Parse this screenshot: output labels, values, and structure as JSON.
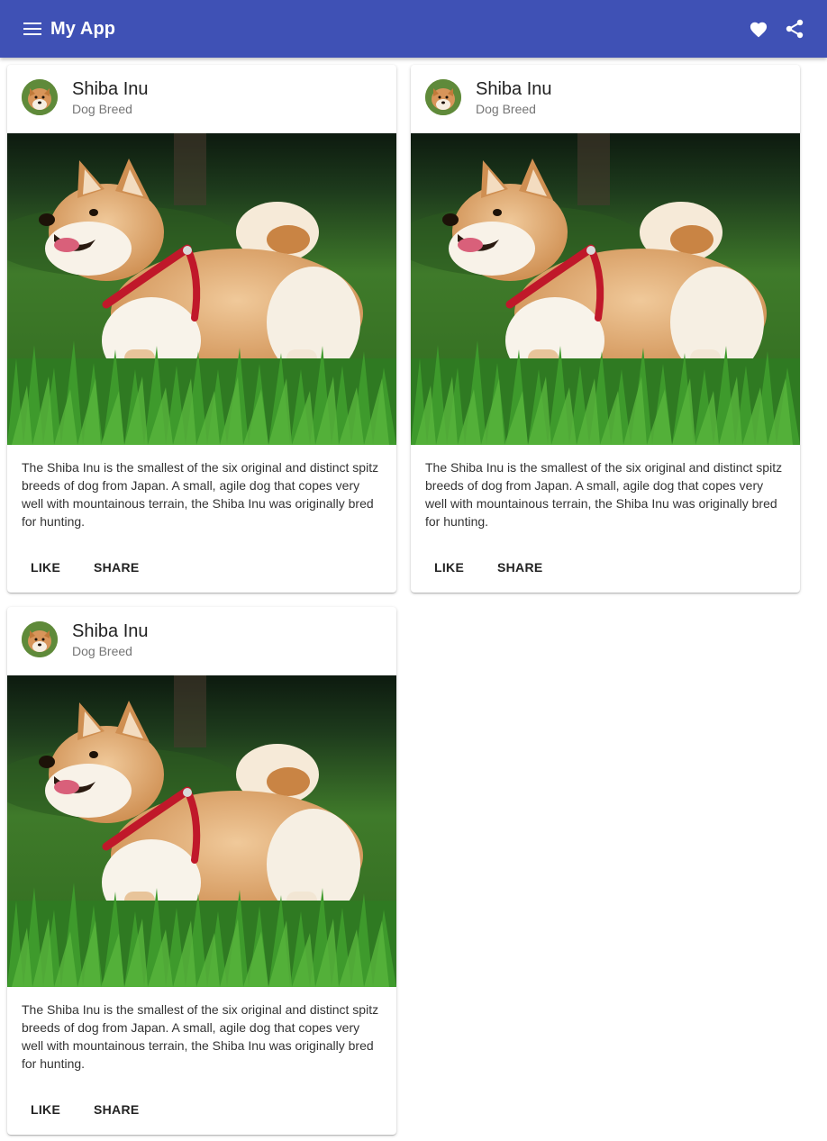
{
  "toolbar": {
    "title": "My App",
    "background": "#3f51b5",
    "icons": [
      "menu-icon",
      "heart-icon",
      "share-icon"
    ]
  },
  "cards": [
    {
      "title": "Shiba Inu",
      "subtitle": "Dog Breed",
      "description": "The Shiba Inu is the smallest of the six original and distinct spitz breeds of dog from Japan. A small, agile dog that copes very well with mountainous terrain, the Shiba Inu was originally bred for hunting.",
      "actions": [
        "LIKE",
        "SHARE"
      ]
    },
    {
      "title": "Shiba Inu",
      "subtitle": "Dog Breed",
      "description": "The Shiba Inu is the smallest of the six original and distinct spitz breeds of dog from Japan. A small, agile dog that copes very well with mountainous terrain, the Shiba Inu was originally bred for hunting.",
      "actions": [
        "LIKE",
        "SHARE"
      ]
    },
    {
      "title": "Shiba Inu",
      "subtitle": "Dog Breed",
      "description": "The Shiba Inu is the smallest of the six original and distinct spitz breeds of dog from Japan. A small, agile dog that copes very well with mountainous terrain, the Shiba Inu was originally bred for hunting.",
      "actions": [
        "LIKE",
        "SHARE"
      ]
    }
  ]
}
